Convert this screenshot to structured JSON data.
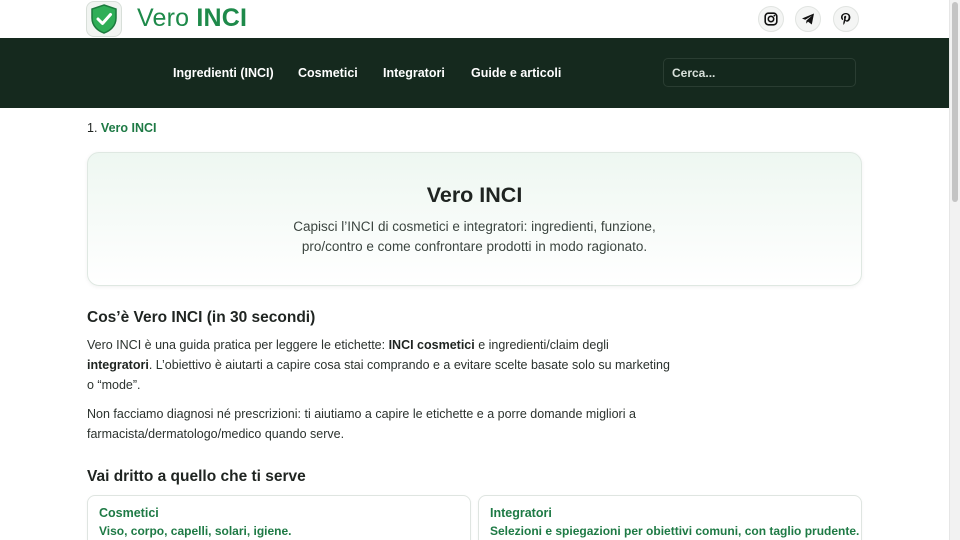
{
  "brand": {
    "name_part1": "Vero",
    "name_part2": "INCI",
    "logo_icon": "shield-check-icon",
    "color": "#1e8a4a"
  },
  "social": [
    {
      "name": "instagram-icon"
    },
    {
      "name": "telegram-icon"
    },
    {
      "name": "pinterest-icon"
    }
  ],
  "nav": {
    "items": [
      {
        "label": "Ingredienti (INCI)"
      },
      {
        "label": "Cosmetici"
      },
      {
        "label": "Integratori"
      },
      {
        "label": "Guide e articoli"
      }
    ],
    "search_placeholder": "Cerca...",
    "background": "#15291e"
  },
  "breadcrumb": {
    "number": "1.",
    "current": "Vero INCI"
  },
  "hero": {
    "title": "Vero INCI",
    "desc_line1": "Capisci l’INCI di cosmetici e integratori: ingredienti, funzione,",
    "desc_line2": "pro/contro e come confrontare prodotti in modo ragionato."
  },
  "about": {
    "heading": "Cos’è Vero INCI (in 30 secondi)",
    "p1": {
      "l1_a": "Vero INCI è una guida pratica per leggere le etichette: ",
      "l1_b": "INCI cosmetici",
      "l1_c": " e ingredienti/claim degli",
      "l2_a": "integratori",
      "l2_b": ". L’obiettivo è aiutarti a capire cosa stai comprando e a evitare scelte basate solo su marketing",
      "l3": "o “mode”."
    },
    "p2": {
      "l1": "Non facciamo diagnosi né prescrizioni: ti aiutiamo a capire le etichette e a porre domande migliori a",
      "l2": "farmacista/dermatologo/medico quando serve."
    }
  },
  "quick": {
    "heading": "Vai dritto a quello che ti serve",
    "cards": [
      {
        "title": "Cosmetici",
        "desc": "Viso, corpo, capelli, solari, igiene."
      },
      {
        "title": "Integratori",
        "desc": "Selezioni e spiegazioni per obiettivi comuni, con taglio prudente."
      }
    ]
  },
  "colors": {
    "accent_green": "#1e7a45",
    "hero_bg": "#eef7f1"
  }
}
